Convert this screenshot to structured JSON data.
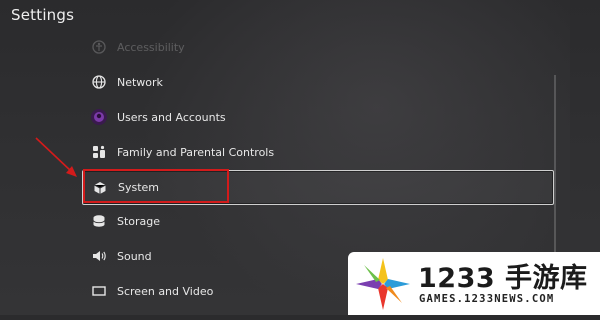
{
  "header": {
    "title": "Settings"
  },
  "menu": {
    "items": [
      {
        "label": "Accessibility",
        "icon": "accessibility-icon"
      },
      {
        "label": "Network",
        "icon": "globe-icon"
      },
      {
        "label": "Users and Accounts",
        "icon": "user-avatar-icon"
      },
      {
        "label": "Family and Parental Controls",
        "icon": "family-icon"
      },
      {
        "label": "System",
        "icon": "cube-icon"
      },
      {
        "label": "Storage",
        "icon": "storage-icon"
      },
      {
        "label": "Sound",
        "icon": "speaker-icon"
      },
      {
        "label": "Screen and Video",
        "icon": "screen-icon"
      }
    ],
    "selected": "System"
  },
  "annotation": {
    "highlight_color": "#d31b1b"
  },
  "watermark": {
    "name": "1233 手游库",
    "domain": "GAMES.1233NEWS.COM"
  }
}
